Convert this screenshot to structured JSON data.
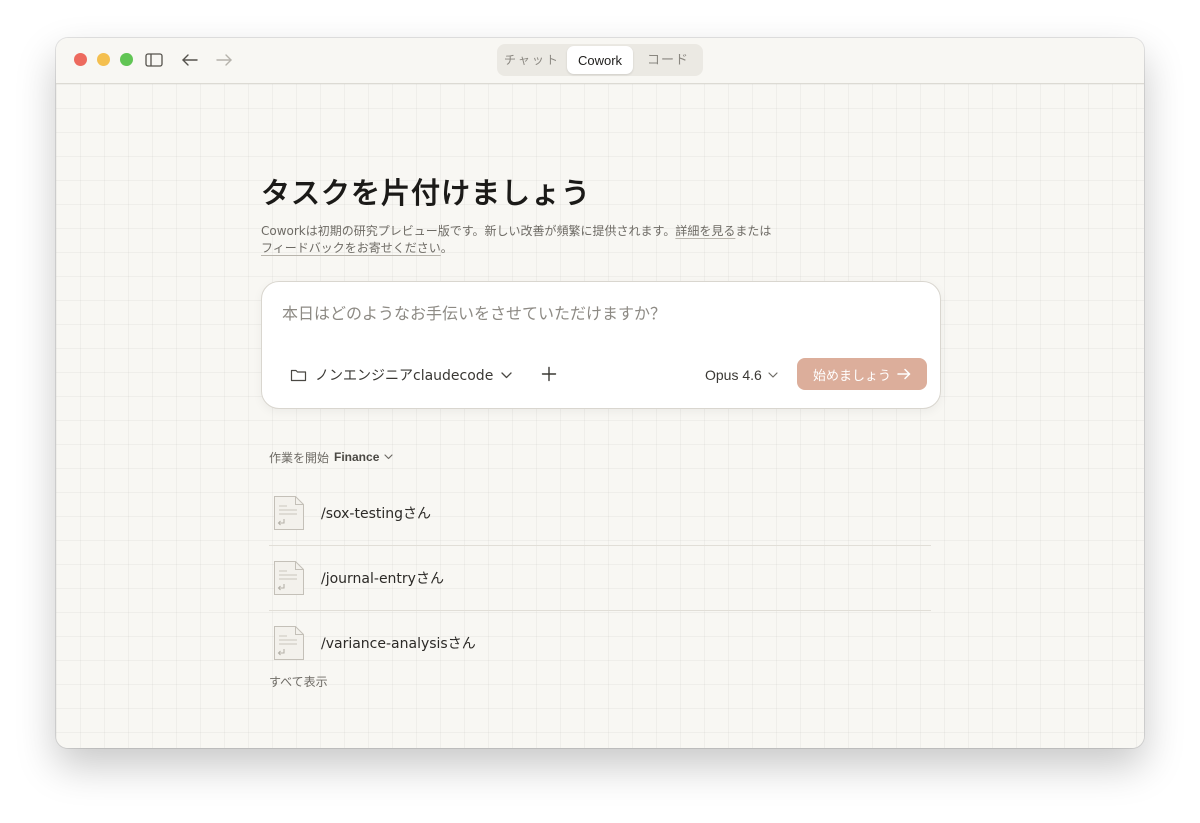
{
  "tabs": [
    {
      "label": "チャット",
      "active": false
    },
    {
      "label": "Cowork",
      "active": true
    },
    {
      "label": "コード",
      "active": false
    }
  ],
  "main": {
    "heading": "タスクを片付けましょう",
    "subtitle_prefix": "Coworkは初期の研究プレビュー版です。新しい改善が頻繁に提供されます。",
    "learn_more_link": "詳細を見る",
    "subtitle_middle": "または",
    "feedback_link": "フィードバックをお寄せください",
    "subtitle_suffix": "。"
  },
  "prompt": {
    "placeholder": "本日はどのようなお手伝いをさせていただけますか？",
    "value": "",
    "folder_label": "ノンエンジニアclaudecode",
    "add_symbol": "+",
    "model_label": "Opus 4.6",
    "start_label": "始めましょう"
  },
  "tasks": {
    "section_prefix": "作業を開始",
    "category": "Finance",
    "items": [
      {
        "label": "/sox-testingさん"
      },
      {
        "label": "/journal-entryさん"
      },
      {
        "label": "/variance-analysisさん"
      }
    ],
    "show_all_label": "すべて表示"
  },
  "colors": {
    "accent_button": "#dcae9b",
    "window_background": "#f8f7f3",
    "close": "#ed6a5e",
    "minimize": "#f4bf4f",
    "maximize": "#61c554"
  },
  "icons": {
    "sidebar": "sidebar-icon",
    "back": "arrow-left-icon",
    "forward": "arrow-right-icon",
    "folder": "folder-icon",
    "add": "plus-icon",
    "chevron": "chevron-down-icon",
    "send": "arrow-right-icon",
    "task": "document-icon"
  }
}
